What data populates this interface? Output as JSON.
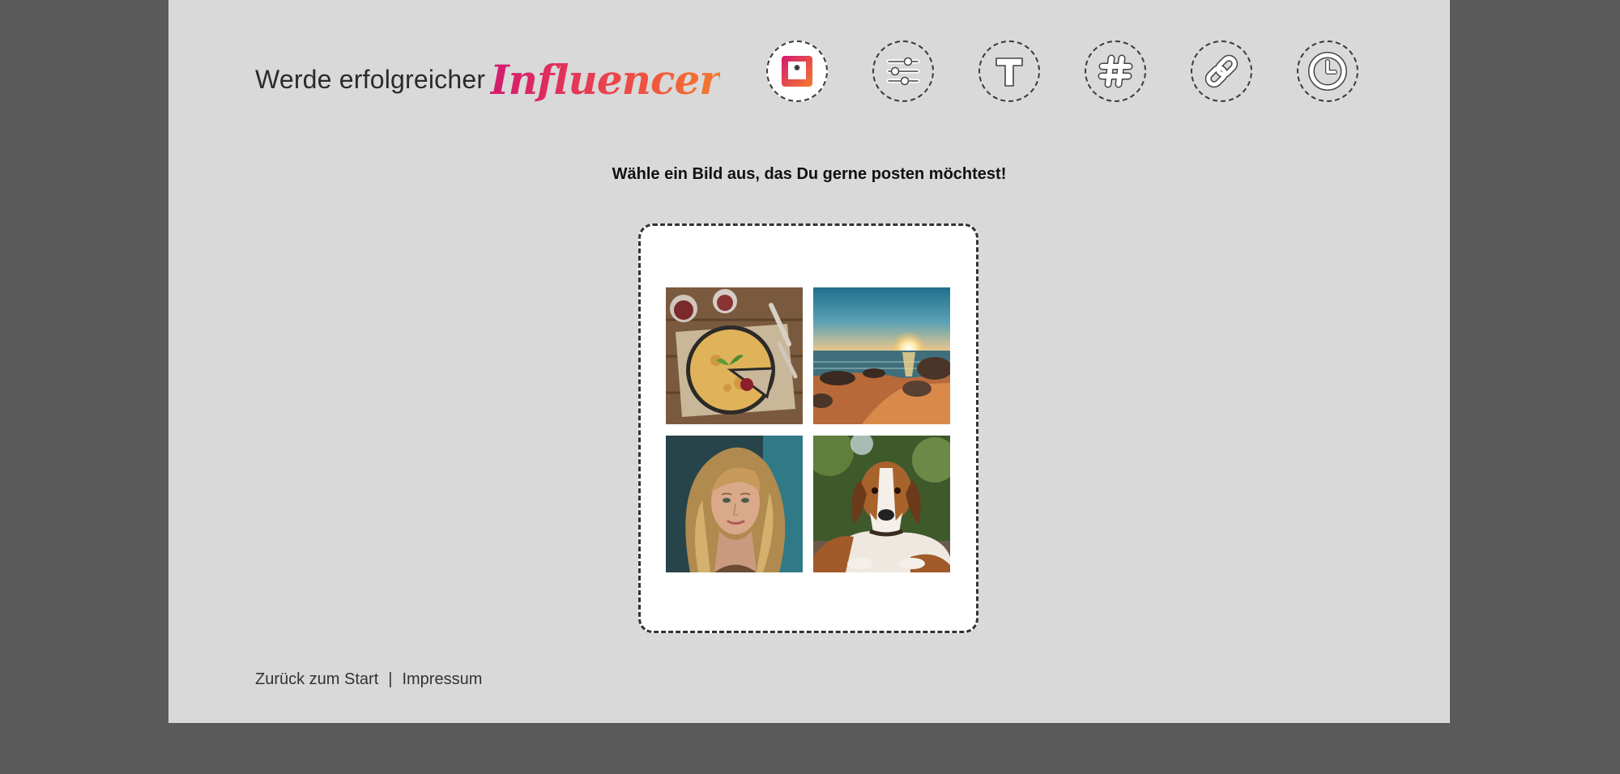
{
  "header": {
    "prefix": "Werde erfolgreicher",
    "brand": "Influencer"
  },
  "steps": [
    {
      "name": "image-step",
      "icon": "image-frame-icon",
      "active": true
    },
    {
      "name": "filter-step",
      "icon": "sliders-icon",
      "active": false
    },
    {
      "name": "text-step",
      "icon": "text-t-icon",
      "active": false
    },
    {
      "name": "hashtag-step",
      "icon": "hashtag-icon",
      "active": false
    },
    {
      "name": "link-step",
      "icon": "chain-link-icon",
      "active": false
    },
    {
      "name": "time-step",
      "icon": "clock-icon",
      "active": false
    }
  ],
  "main": {
    "instruction": "Wähle ein Bild aus, das Du gerne posten möchtest!",
    "images": [
      {
        "name": "image-quiche",
        "depicts": "quiche"
      },
      {
        "name": "image-sunset-beach",
        "depicts": "sunset-beach"
      },
      {
        "name": "image-woman-portrait",
        "depicts": "woman-portrait"
      },
      {
        "name": "image-beagle",
        "depicts": "beagle-dog"
      }
    ]
  },
  "footer": {
    "back_link": "Zurück zum Start",
    "separator": "|",
    "imprint_link": "Impressum"
  },
  "colors": {
    "outer_background": "#5a5a5a",
    "page_background": "#d9d9d9",
    "brand_gradient_start": "#d31a70",
    "brand_gradient_end": "#f47a2d",
    "card_background": "#ffffff"
  }
}
